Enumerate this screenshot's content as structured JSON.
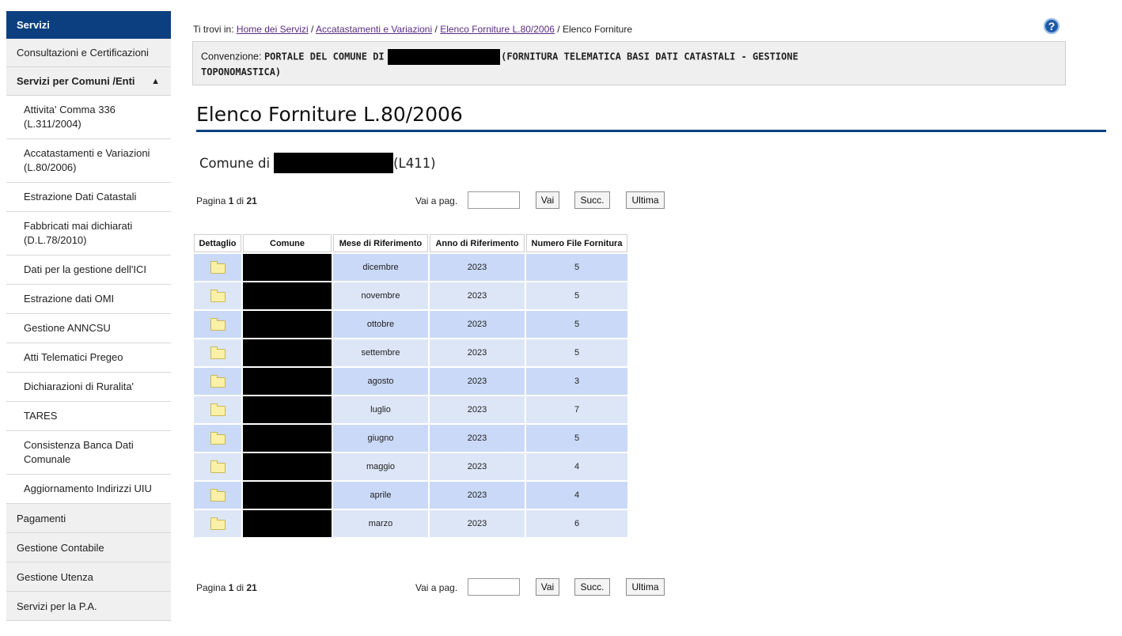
{
  "sidebar": {
    "header": "Servizi",
    "top_items": [
      {
        "label": "Consultazioni e Certificazioni"
      },
      {
        "label": "Servizi per Comuni /Enti"
      }
    ],
    "sub_items": [
      {
        "label": "Attivita' Comma 336 (L.311/2004)"
      },
      {
        "label": "Accatastamenti e Variazioni (L.80/2006)"
      },
      {
        "label": "Estrazione Dati Catastali"
      },
      {
        "label": "Fabbricati mai dichiarati (D.L.78/2010)"
      },
      {
        "label": "Dati per la gestione dell'ICI"
      },
      {
        "label": "Estrazione dati OMI"
      },
      {
        "label": "Gestione ANNCSU"
      },
      {
        "label": "Atti Telematici Pregeo"
      },
      {
        "label": "Dichiarazioni di Ruralita'"
      },
      {
        "label": "TARES"
      },
      {
        "label": "Consistenza Banca Dati Comunale"
      },
      {
        "label": "Aggiornamento Indirizzi UIU"
      }
    ],
    "bottom_items": [
      {
        "label": "Pagamenti"
      },
      {
        "label": "Gestione Contabile"
      },
      {
        "label": "Gestione Utenza"
      },
      {
        "label": "Servizi per la P.A."
      }
    ]
  },
  "breadcrumb": {
    "prefix": "Ti trovi in:",
    "links": [
      "Home dei Servizi",
      "Accatastamenti e Variazioni",
      "Elenco Forniture L.80/2006"
    ],
    "separator": "/",
    "current": "Elenco Forniture"
  },
  "convention": {
    "label": "Convenzione:",
    "value_start": "PORTALE DEL COMUNE DI",
    "value_end": "(FORNITURA TELEMATICA BASI DATI CATASTALI - GESTIONE",
    "value_line2": "TOPONOMASTICA)"
  },
  "page_title": "Elenco Forniture L.80/2006",
  "comune": {
    "prefix": "Comune di",
    "code": "(L411)"
  },
  "pager": {
    "page_label": "Pagina",
    "current": "1",
    "of_label": "di",
    "total": "21",
    "goto_label": "Vai a pag.",
    "goto_value": "",
    "go_button": "Vai",
    "next_button": "Succ.",
    "last_button": "Ultima"
  },
  "table": {
    "headers": [
      "Dettaglio",
      "Comune",
      "Mese di Riferimento",
      "Anno di Riferimento",
      "Numero File Fornitura"
    ],
    "rows": [
      {
        "mese": "dicembre",
        "anno": "2023",
        "num": "5"
      },
      {
        "mese": "novembre",
        "anno": "2023",
        "num": "5"
      },
      {
        "mese": "ottobre",
        "anno": "2023",
        "num": "5"
      },
      {
        "mese": "settembre",
        "anno": "2023",
        "num": "5"
      },
      {
        "mese": "agosto",
        "anno": "2023",
        "num": "3"
      },
      {
        "mese": "luglio",
        "anno": "2023",
        "num": "7"
      },
      {
        "mese": "giugno",
        "anno": "2023",
        "num": "5"
      },
      {
        "mese": "maggio",
        "anno": "2023",
        "num": "4"
      },
      {
        "mese": "aprile",
        "anno": "2023",
        "num": "4"
      },
      {
        "mese": "marzo",
        "anno": "2023",
        "num": "6"
      }
    ]
  },
  "colors": {
    "brand_blue": "#0b3f80",
    "row_odd": "#cad9f7",
    "row_even": "#dde6f7",
    "link": "#5a2d82"
  },
  "icons": {
    "help": "help-icon",
    "folder": "folder-icon",
    "chevron": "chevron-up-icon"
  }
}
